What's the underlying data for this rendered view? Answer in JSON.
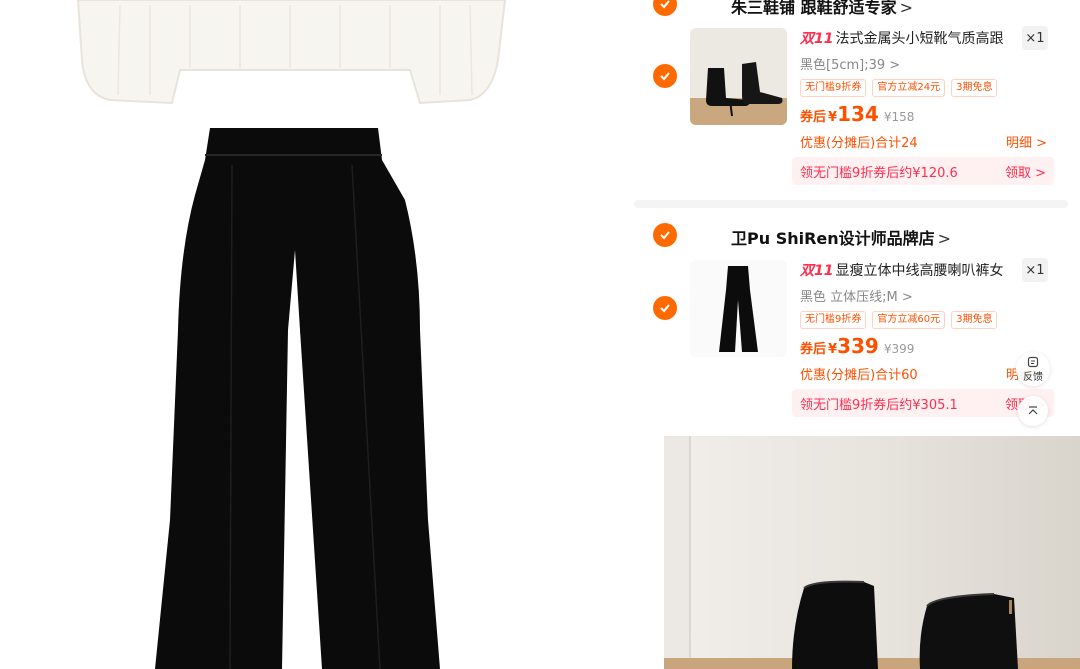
{
  "shops": [
    {
      "name": "朱三鞋铺 跟鞋舒适专家",
      "chevron": ">",
      "item": {
        "badge": "双11",
        "title": "法式金属头小短靴气质高跟",
        "qty": "×1",
        "sku": "黑色[5cm];39",
        "sku_chevron": ">",
        "tags": [
          "无门槛9折券",
          "官方立减24元",
          "3期免息"
        ],
        "price_prefix": "券后",
        "currency": "¥",
        "price": "134",
        "original_price": "¥158",
        "discount_text": "优惠(分摊后)合计24",
        "detail_link": "明细 >",
        "coupon_text": "领无门槛9折券后约¥120.6",
        "coupon_action": "领取 >"
      }
    },
    {
      "name": "卫Pu ShiRen设计师品牌店",
      "chevron": ">",
      "item": {
        "badge": "双11",
        "title": "显瘦立体中线高腰喇叭裤女",
        "qty": "×1",
        "sku": "黑色 立体压线;M",
        "sku_chevron": ">",
        "tags": [
          "无门槛9折券",
          "官方立减60元",
          "3期免息"
        ],
        "price_prefix": "券后",
        "currency": "¥",
        "price": "339",
        "original_price": "¥399",
        "discount_text": "优惠(分摊后)合计60",
        "detail_link": "明细 >",
        "coupon_text": "领无门槛9折券后约¥305.1",
        "coupon_action": "领取 >"
      }
    }
  ],
  "float_buttons": {
    "feedback_label": "反馈"
  },
  "colors": {
    "accent": "#ff6a00",
    "price": "#ff5000",
    "badge": "#ff2e4d",
    "coupon_bg": "#fff0f2"
  }
}
